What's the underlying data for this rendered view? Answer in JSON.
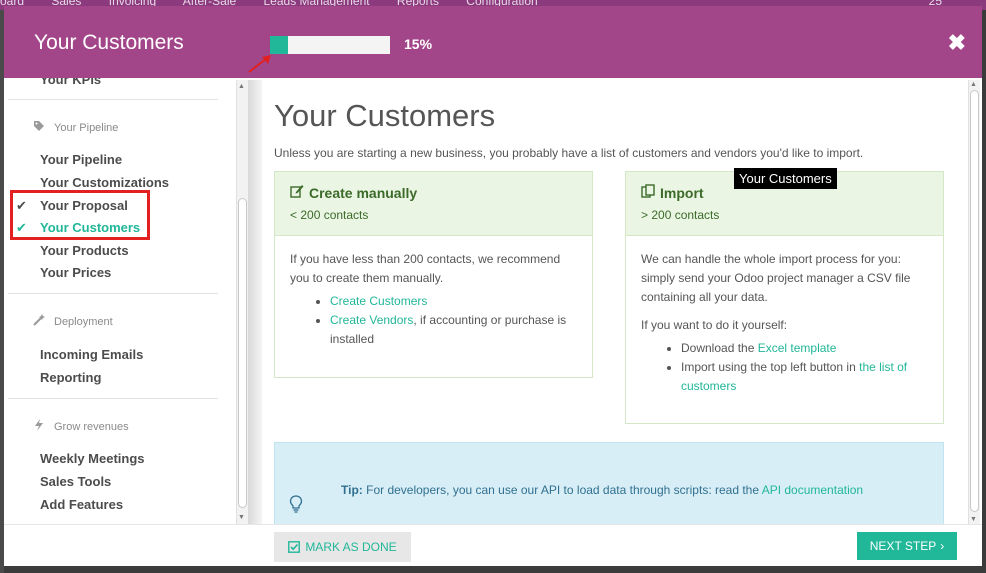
{
  "topnav": {
    "items": [
      "oard",
      "Sales",
      "Invoicing",
      "After-Sale",
      "Leads Management",
      "Reports",
      "Configuration"
    ],
    "right": "25"
  },
  "header": {
    "title": "Your Customers",
    "progress_pct": 15,
    "progress_label": "15%",
    "close_glyph": "✖"
  },
  "sidebar": {
    "partial_item": "Your KPIs",
    "categories": [
      {
        "label": "Your Pipeline",
        "icon": "tag-icon"
      },
      {
        "label": "Deployment",
        "icon": "magic-wand-icon"
      },
      {
        "label": "Grow revenues",
        "icon": "bolt-icon"
      }
    ],
    "items": [
      "Your Pipeline",
      "Your Customizations",
      "Your Proposal",
      "Your Customers",
      "Your Products",
      "Your Prices",
      "Incoming Emails",
      "Reporting",
      "Weekly Meetings",
      "Sales Tools",
      "Add Features"
    ],
    "check_glyph": "✔"
  },
  "content": {
    "title": "Your Customers",
    "intro": "Unless you are starting a new business, you probably have a list of customers and vendors you'd like to import.",
    "tooltip": "Your Customers",
    "manual": {
      "title": "Create manually",
      "subtitle": "< 200 contacts",
      "body": "If you have less than 200 contacts, we recommend you to create them manually.",
      "li1_link": "Create Customers",
      "li2_link": "Create Vendors",
      "li2_rest": ", if accounting or purchase is installed"
    },
    "import": {
      "title": "Import",
      "subtitle": "> 200 contacts",
      "body": "We can handle the whole import process for you: simply send your Odoo project manager a CSV file containing all your data.",
      "body2": "If you want to do it yourself:",
      "li1_text": "Download the ",
      "li1_link": "Excel template",
      "li2_text": "Import using the top left button in ",
      "li2_link": "the list of customers"
    },
    "tip": {
      "label": "Tip:",
      "text": " For developers, you can use our API to load data through scripts: read the ",
      "link": "API documentation"
    }
  },
  "footer": {
    "mark_done": "MARK AS DONE",
    "next_step": "NEXT STEP",
    "next_glyph": "›"
  },
  "colors": {
    "header": "#a24689",
    "accent": "#21b799",
    "card_head": "#eaf6e3",
    "tip_bg": "#d7eef7",
    "highlight": "#e32020"
  }
}
